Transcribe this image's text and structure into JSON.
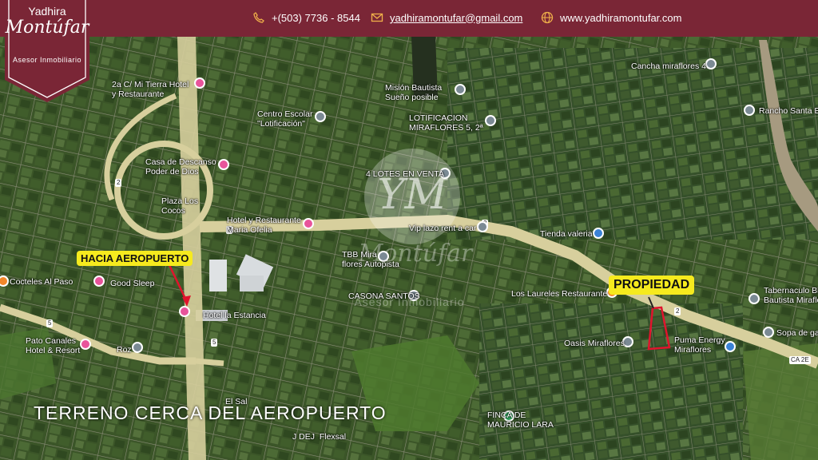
{
  "header": {
    "phone": "+(503) 7736 - 8544",
    "email": "yadhiramontufar@gmail.com",
    "website": "www.yadhiramontufar.com",
    "phone_icon": "phone-icon",
    "email_icon": "envelope-icon",
    "web_icon": "globe-icon",
    "accent_color": "#f0b04a"
  },
  "logo": {
    "first_name": "Yadhira",
    "last_name": "Montúfar",
    "tagline": "Asesor Inmobiliario"
  },
  "colors": {
    "brand": "#7a2636",
    "callout": "#f6ea1e",
    "property_outline": "#e0142d"
  },
  "places": [
    {
      "id": "mi-tierra",
      "label": "2a C/ Mi Tierra Hotel\ny Restaurante",
      "kind": "pink"
    },
    {
      "id": "centro-escolar",
      "label": "Centro Escolar\n\"Lotificación\"",
      "kind": "gray"
    },
    {
      "id": "mision-bautista",
      "label": "Misión Bautista\nSueño posible",
      "kind": "gray"
    },
    {
      "id": "lotificacion",
      "label": "LOTIFICACION\nMIRAFLORES 5, 2ª",
      "kind": "gray"
    },
    {
      "id": "cancha",
      "label": "Cancha miraflores 4",
      "kind": "gray"
    },
    {
      "id": "rancho",
      "label": "Rancho Santa B",
      "kind": "gray"
    },
    {
      "id": "casa-descanso",
      "label": "Casa de Descanso\nPoder de Dios",
      "kind": "pink"
    },
    {
      "id": "lotes",
      "label": "4 LOTES EN VENTA",
      "kind": "gray"
    },
    {
      "id": "plaza",
      "label": "Plaza Los\nCocos",
      "kind": "text"
    },
    {
      "id": "hotel-maria",
      "label": "Hotel y Restaurante\nMaria Ofelia",
      "kind": "pink"
    },
    {
      "id": "vip-lazo",
      "label": "Vip lazo rent a car",
      "kind": "gray"
    },
    {
      "id": "tienda",
      "label": "Tienda valeria",
      "kind": "blue"
    },
    {
      "id": "tbb",
      "label": "TBB Mira\nflores Autopista",
      "kind": "gray"
    },
    {
      "id": "tabernaculo",
      "label": "Tabernaculo Bi\nBautista Miraflo",
      "kind": "gray"
    },
    {
      "id": "coctel",
      "label": "Cocteles Al Paso",
      "kind": "orange"
    },
    {
      "id": "good-sleep",
      "label": "Good Sleep",
      "kind": "pink"
    },
    {
      "id": "casona",
      "label": "CASONA SANTOS",
      "kind": "gray"
    },
    {
      "id": "laureles",
      "label": "Los Laureles Restaurante",
      "kind": "orange"
    },
    {
      "id": "hotel-estancia",
      "label": "Hotel la Estancia",
      "kind": "pink"
    },
    {
      "id": "sopa",
      "label": "Sopa de ga",
      "kind": "gray"
    },
    {
      "id": "oasis",
      "label": "Oasis Miraflores",
      "kind": "gray"
    },
    {
      "id": "puma",
      "label": "Puma Energy\nMiraflores",
      "kind": "blue"
    },
    {
      "id": "pato-canales",
      "label": "Pato Canales\nHotel & Resort",
      "kind": "pink"
    },
    {
      "id": "roz",
      "label": "Roz",
      "kind": "gray"
    },
    {
      "id": "finca",
      "label": "FINCA DE\nMAURICIO LARA",
      "kind": "green"
    },
    {
      "id": "jdej",
      "label": "J DEJ  Flexsal",
      "kind": "text"
    },
    {
      "id": "el-sal",
      "label": "El Sal",
      "kind": "text"
    }
  ],
  "callouts": {
    "airport": "HACIA AEROPUERTO",
    "property": "PROPIEDAD"
  },
  "title": "TERRENO CERCA DEL AEROPUERTO",
  "watermark": {
    "mark": "YM",
    "script": "Montúfar",
    "tagline": "Asesor Inmobiliario"
  },
  "routes": [
    "2",
    "2",
    "2",
    "2",
    "5",
    "5",
    "CA 2E"
  ]
}
